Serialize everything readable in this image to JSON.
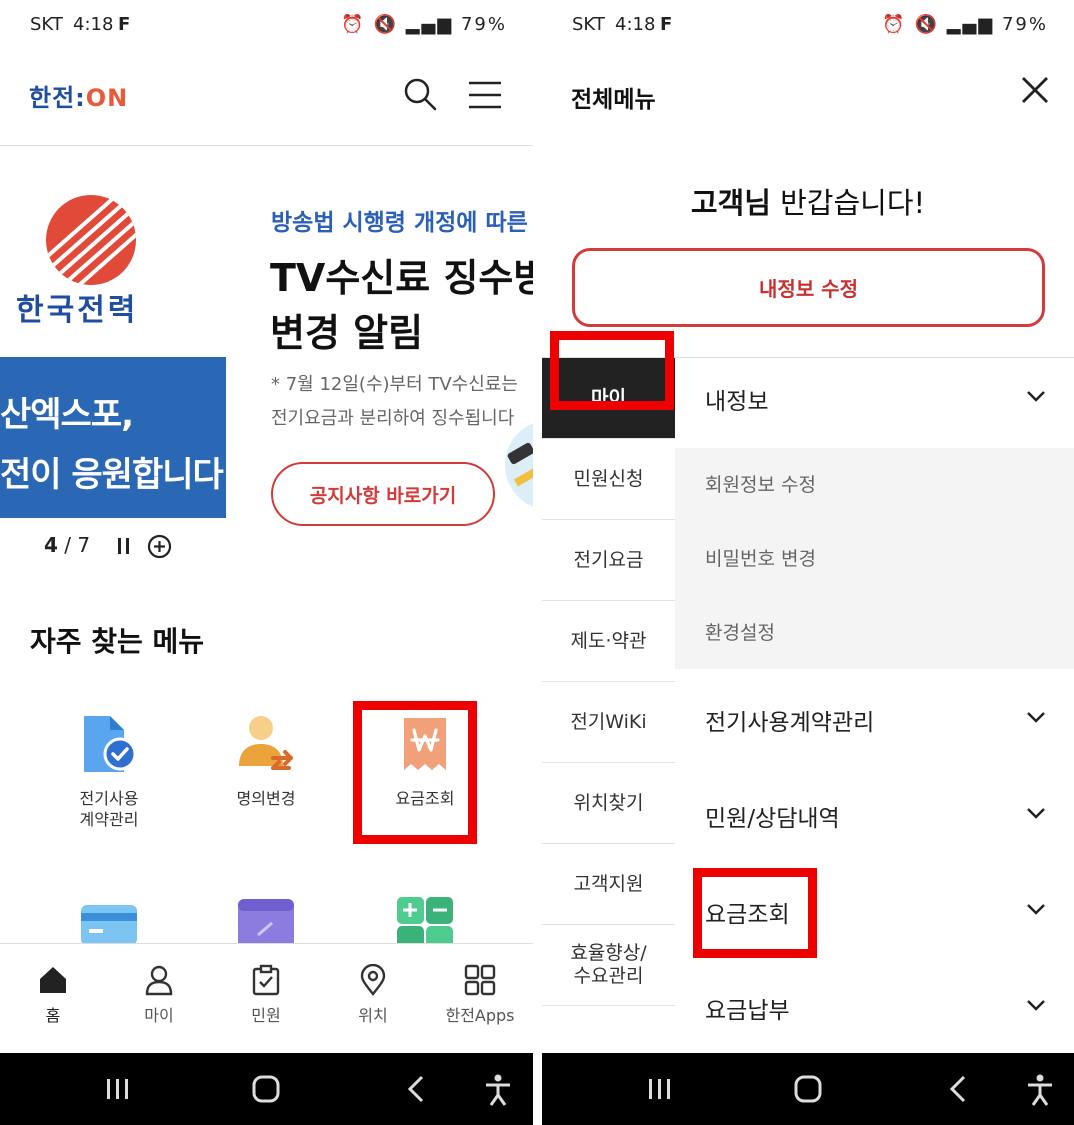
{
  "left": {
    "status": {
      "carrier": "SKT",
      "time": "4:18",
      "icons": "F",
      "battery": "79%"
    },
    "header": {
      "logo_main": "한전:",
      "logo_on": "ON"
    },
    "banner": {
      "brand_name": "한국전력",
      "expo_line1": "산엑스포,",
      "expo_line2": "전이 응원합니다.",
      "subtitle": "방송법 시행령 개정에 따른",
      "title_line1": "TV수신료 징수방",
      "title_line2": "변경 알림",
      "desc_line1": "* 7월 12일(수)부터 TV수신료는",
      "desc_line2": "전기요금과 분리하여 징수됩니다",
      "button": "공지사항 바로가기",
      "pager_current": "4",
      "pager_total": "/ 7"
    },
    "frequent": {
      "title": "자주 찾는 메뉴",
      "items": [
        {
          "label_line1": "전기사용",
          "label_line2": "계약관리"
        },
        {
          "label_line1": "명의변경",
          "label_line2": ""
        },
        {
          "label_line1": "요금조회",
          "label_line2": ""
        }
      ]
    },
    "bottom_nav": [
      {
        "label": "홈"
      },
      {
        "label": "마이"
      },
      {
        "label": "민원"
      },
      {
        "label": "위치"
      },
      {
        "label": "한전Apps"
      }
    ]
  },
  "right": {
    "status": {
      "carrier": "SKT",
      "time": "4:18",
      "icons": "F",
      "battery": "79%"
    },
    "title": "전체메뉴",
    "greeting_name": "고객님",
    "greeting_rest": " 반갑습니다!",
    "edit_button": "내정보 수정",
    "side_menu": [
      {
        "line1": "마이",
        "line2": ""
      },
      {
        "line1": "민원신청",
        "line2": ""
      },
      {
        "line1": "전기요금",
        "line2": ""
      },
      {
        "line1": "제도·약관",
        "line2": ""
      },
      {
        "line1": "전기WiKi",
        "line2": ""
      },
      {
        "line1": "위치찾기",
        "line2": ""
      },
      {
        "line1": "고객지원",
        "line2": ""
      },
      {
        "line1": "효율향상/",
        "line2": "수요관리"
      }
    ],
    "sections": [
      {
        "label": "내정보"
      },
      {
        "label": "전기사용계약관리"
      },
      {
        "label": "민원/상담내역"
      },
      {
        "label": "요금조회"
      },
      {
        "label": "요금납부"
      }
    ],
    "sub_items": [
      {
        "label": "회원정보 수정"
      },
      {
        "label": "비밀번호 변경"
      },
      {
        "label": "환경설정"
      }
    ]
  },
  "colors": {
    "brand_blue": "#1f4da0",
    "accent_red": "#d33a3a",
    "highlight": "#ee0000"
  }
}
